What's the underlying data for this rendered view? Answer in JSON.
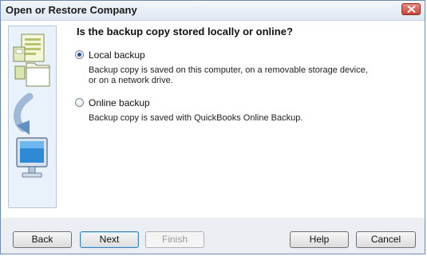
{
  "window": {
    "title": "Open or Restore Company",
    "close_icon": "close-icon"
  },
  "main": {
    "heading": "Is the backup copy stored locally or online?",
    "options": [
      {
        "label": "Local backup",
        "description": "Backup copy is saved on this computer, on a removable storage device, or on a network drive.",
        "selected": true
      },
      {
        "label": "Online backup",
        "description": "Backup copy is saved with QuickBooks Online Backup.",
        "selected": false
      }
    ]
  },
  "buttons": {
    "back": "Back",
    "next": "Next",
    "finish": "Finish",
    "help": "Help",
    "cancel": "Cancel"
  },
  "side_art": {
    "icons": [
      "document-icon",
      "folder-icon",
      "arrow-down-icon",
      "monitor-icon"
    ]
  },
  "colors": {
    "title_bar": "#dfe8f3",
    "window_border": "#6e8cb3",
    "side_panel": "#e9f1fb",
    "close_button": "#c7453a",
    "default_button_border": "#3c7fb1"
  }
}
